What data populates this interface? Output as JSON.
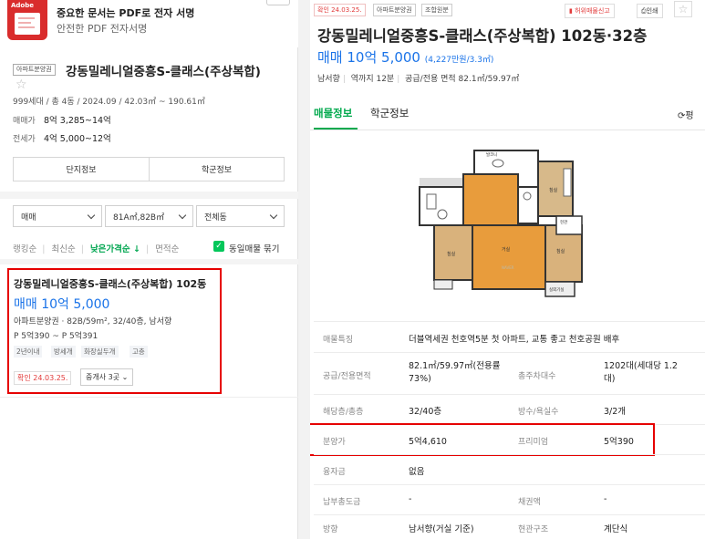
{
  "ad": {
    "logo_text": "Adobe",
    "title": "중요한 문서는 PDF로 전자 서명",
    "subtitle": "안전한 PDF 전자서명"
  },
  "complex": {
    "badge": "아파트분양권",
    "name": "강동밀레니얼중흥S-클래스(주상복합)",
    "summary": "999세대 / 총 4동 / 2024.09 / 42.03㎡ ~ 190.61㎡",
    "sale_label": "매매가",
    "sale_value": "8억 3,285~14억",
    "lease_label": "전세가",
    "lease_value": "4억 5,000~12억",
    "btn_info": "단지정보",
    "btn_school": "학군정보"
  },
  "filters": {
    "trade": "매매",
    "area": "81A㎡,82B㎡",
    "dong": "전체동"
  },
  "sorts": {
    "items": [
      "랭킹순",
      "최신순",
      "낮은가격순 ↓",
      "면적순"
    ],
    "same_check": "동일매물 묶기"
  },
  "listing": {
    "title": "강동밀레니얼중흥S-클래스(주상복합) 102동",
    "price": "매매 10억 5,000",
    "line1": "아파트분양권 · 82B/59m², 32/40층, 남서향",
    "line2": "P 5억390 ~ P 5억391",
    "tags": [
      "2년이내",
      "방세개",
      "화장실두개",
      "고층"
    ],
    "confirm": "확인 24.03.25.",
    "agent": "중개사 3곳 ⌄"
  },
  "detail": {
    "badges": [
      "확인 24.03.25.",
      "아파트분양권",
      "조합원분"
    ],
    "report": "허위매물신고",
    "print": "인쇄",
    "title": "강동밀레니얼중흥S-클래스(주상복합) 102동·32층",
    "price": "매매 10억 5,000",
    "price_sub": "(4,227만원/3.3㎡)",
    "sub": [
      "남서향",
      "역까지 12분",
      "공급/전용 면적 82.1㎡/59.97㎡"
    ],
    "tabs": [
      "매물정보",
      "학군정보"
    ],
    "refresh": "평"
  },
  "floorplan": {
    "rooms": [
      "침실",
      "거실",
      "침실",
      "침실",
      "발코니",
      "현관",
      "드레스룸",
      "실외기실"
    ]
  },
  "table": {
    "r1": {
      "h": "매물특징",
      "v": "더블역세권 천호역5분 첫 아파트, 교통 좋고 천호공원 배후"
    },
    "r2": {
      "h1": "공급/전용면적",
      "v1": "82.1㎡/59.97㎡(전용률73%)",
      "h2": "총주차대수",
      "v2": "1202대(세대당 1.2대)"
    },
    "r3": {
      "h1": "해당층/총층",
      "v1": "32/40층",
      "h2": "방수/욕실수",
      "v2": "3/2개"
    },
    "r4": {
      "h1": "분양가",
      "v1": "5억4,610",
      "h2": "프리미엄",
      "v2": "5억390"
    },
    "r5": {
      "h1": "융자금",
      "v1": "없음"
    },
    "r6": {
      "h1": "납부총도금",
      "v1": "-",
      "h2": "채권액",
      "v2": "-"
    },
    "r7": {
      "h1": "방향",
      "v1": "남서향(거실 기준)",
      "h2": "현관구조",
      "v2": "계단식"
    }
  }
}
